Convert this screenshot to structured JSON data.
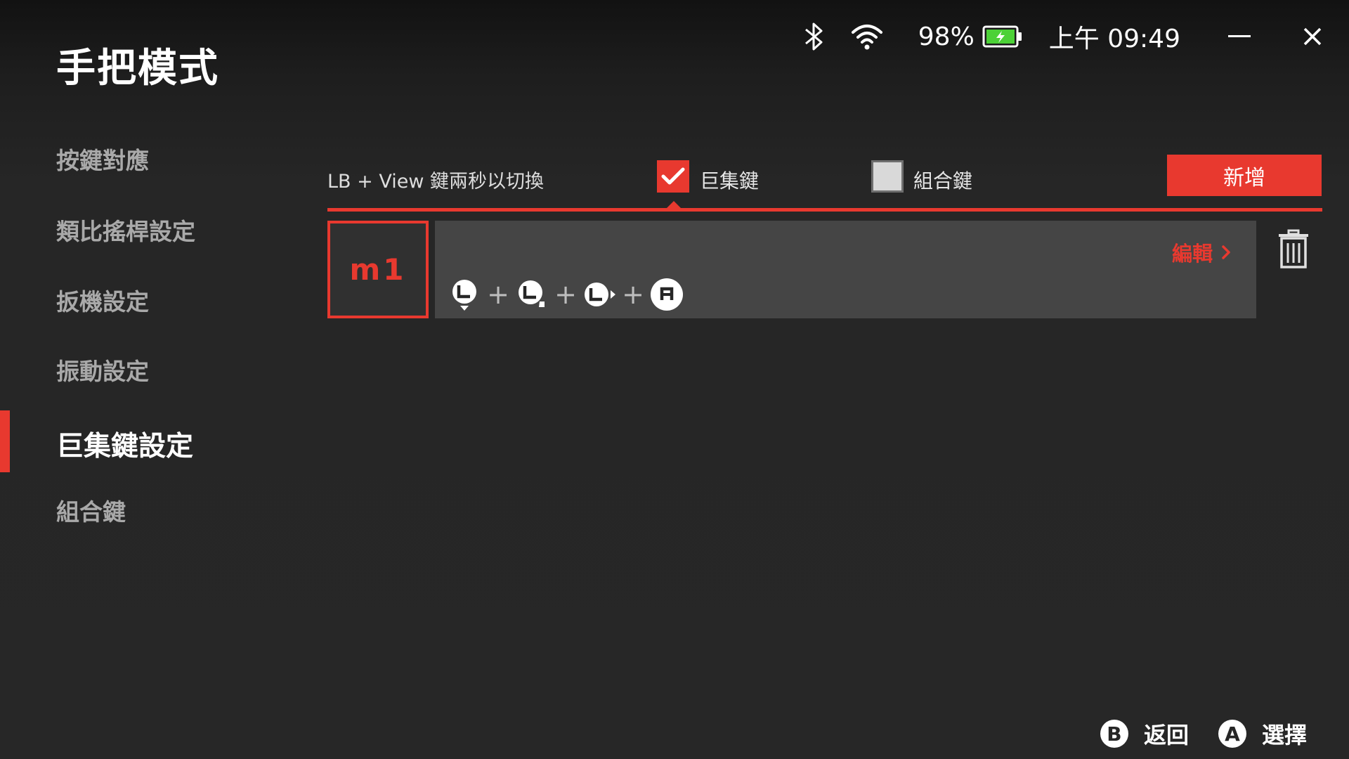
{
  "page": {
    "title": "手把模式"
  },
  "status_bar": {
    "bluetooth_icon": "bluetooth-icon",
    "wifi_icon": "wifi-icon",
    "battery_percent": "98%",
    "battery_icon": "battery-charging-icon",
    "clock": "上午 09:49",
    "minimize_icon": "minimize-icon",
    "close_icon": "close-icon"
  },
  "sidebar": {
    "items": [
      {
        "label": "按鍵對應"
      },
      {
        "label": "類比搖桿設定"
      },
      {
        "label": "扳機設定"
      },
      {
        "label": "振動設定"
      },
      {
        "label": "巨集鍵設定",
        "active": true
      },
      {
        "label": "組合鍵"
      }
    ]
  },
  "toolbar": {
    "hint": "LB + View 鍵兩秒以切換",
    "macro_option": {
      "label": "巨集鍵",
      "checked": true
    },
    "combo_option": {
      "label": "組合鍵",
      "checked": false
    },
    "add_label": "新增"
  },
  "macros": [
    {
      "id_label": "m1",
      "edit_label": "編輯",
      "sequence": [
        {
          "icon": "left-stick-down-icon"
        },
        {
          "icon": "left-stick-down-right-icon"
        },
        {
          "icon": "left-stick-right-icon"
        },
        {
          "icon": "a-button-icon"
        }
      ],
      "plus": "+"
    }
  ],
  "bottom_hints": {
    "back_key": "B",
    "back_label": "返回",
    "select_key": "A",
    "select_label": "選擇"
  },
  "colors": {
    "accent": "#e8392f",
    "background": "#272727",
    "row_background": "#454545"
  }
}
